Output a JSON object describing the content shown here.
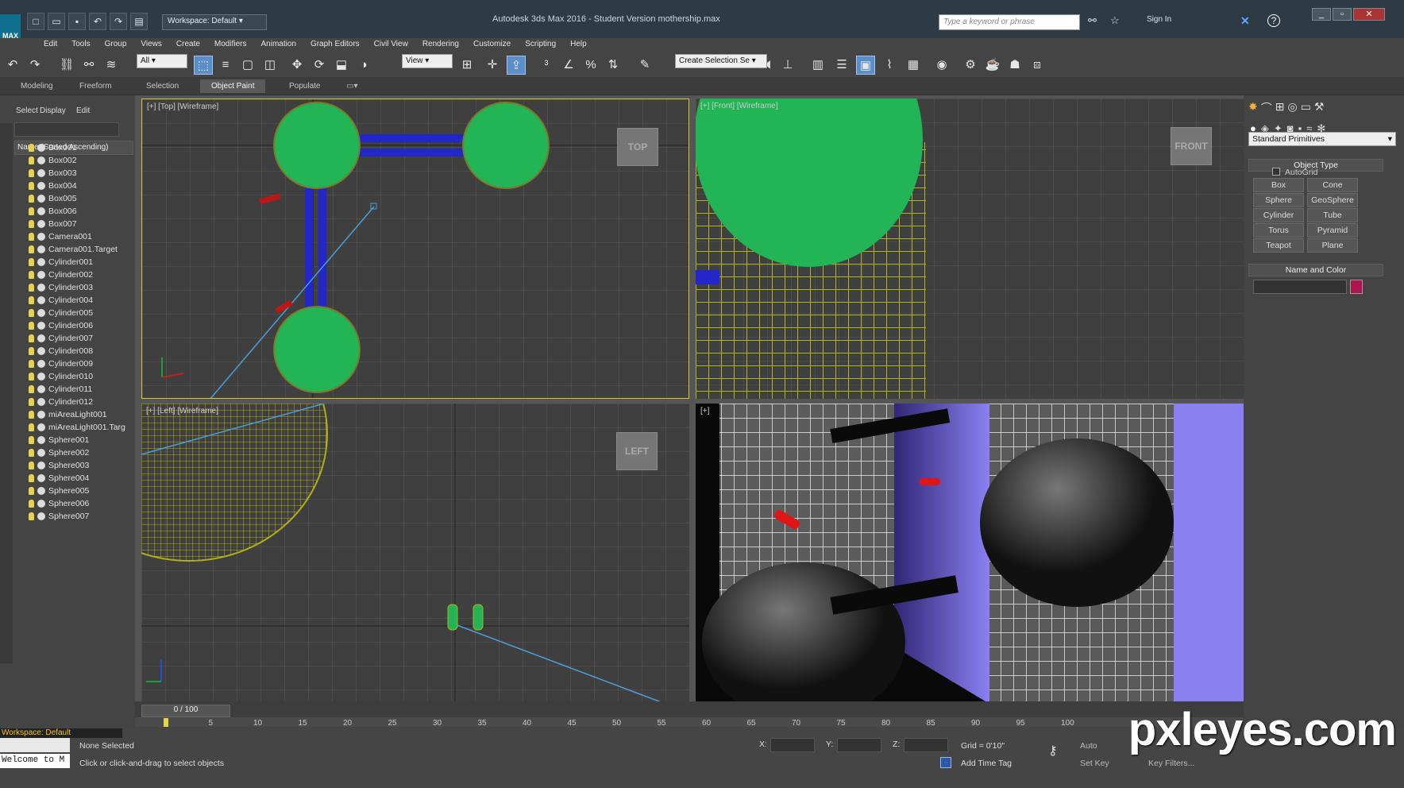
{
  "app": {
    "title": "Autodesk 3ds Max 2016 - Student Version     mothership.max",
    "logo": "MAX",
    "workspace": "Workspace: Default",
    "search_placeholder": "Type a keyword or phrase",
    "sign_in": "Sign In"
  },
  "menu": [
    "Edit",
    "Tools",
    "Group",
    "Views",
    "Create",
    "Modifiers",
    "Animation",
    "Graph Editors",
    "Civil View",
    "Rendering",
    "Customize",
    "Scripting",
    "Help"
  ],
  "toolbar": {
    "filter": "All",
    "view": "View",
    "selection_set": "Create Selection Se"
  },
  "ribbon_tabs": [
    "Modeling",
    "Freeform",
    "Selection",
    "Object Paint",
    "Populate"
  ],
  "ribbon_active": "Object Paint",
  "explorer": {
    "tabs": [
      "Select",
      "Display",
      "Edit"
    ],
    "header": "Name (Sorted Ascending)",
    "items": [
      "Box001",
      "Box002",
      "Box003",
      "Box004",
      "Box005",
      "Box006",
      "Box007",
      "Camera001",
      "Camera001.Target",
      "Cylinder001",
      "Cylinder002",
      "Cylinder003",
      "Cylinder004",
      "Cylinder005",
      "Cylinder006",
      "Cylinder007",
      "Cylinder008",
      "Cylinder009",
      "Cylinder010",
      "Cylinder011",
      "Cylinder012",
      "miAreaLight001",
      "miAreaLight001.Targ",
      "Sphere001",
      "Sphere002",
      "Sphere003",
      "Sphere004",
      "Sphere005",
      "Sphere006",
      "Sphere007"
    ]
  },
  "viewports": {
    "top": {
      "label": "[+] [Top] [Wireframe]",
      "cube": "TOP"
    },
    "front": {
      "label": "[+] [Front] [Wireframe]",
      "cube": "FRONT"
    },
    "left": {
      "label": "[+] [Left] [Wireframe]",
      "cube": "LEFT"
    },
    "camera": {
      "label": "[+]"
    }
  },
  "command_panel": {
    "category": "Standard Primitives",
    "object_type": "Object Type",
    "autogrid": "AutoGrid",
    "buttons": [
      "Box",
      "Cone",
      "Sphere",
      "GeoSphere",
      "Cylinder",
      "Tube",
      "Torus",
      "Pyramid",
      "Teapot",
      "Plane"
    ],
    "name_color": "Name and Color",
    "swatch": "#b0134e"
  },
  "timeline": {
    "frame": "0 / 100",
    "ticks": [
      "0",
      "5",
      "10",
      "15",
      "20",
      "25",
      "30",
      "35",
      "40",
      "45",
      "50",
      "55",
      "60",
      "65",
      "70",
      "75",
      "80",
      "85",
      "90",
      "95",
      "100"
    ]
  },
  "status": {
    "workspace": "Workspace: Default",
    "selected": "None Selected",
    "prompt": "Click or click-and-drag to select objects",
    "script": "Welcome to M",
    "x": "X:",
    "y": "Y:",
    "z": "Z:",
    "grid": "Grid = 0'10\"",
    "add_time_tag": "Add Time Tag",
    "auto": "Auto",
    "set_key": "Set Key",
    "key_filters": "Key Filters..."
  },
  "watermark": "pxleyes.com"
}
